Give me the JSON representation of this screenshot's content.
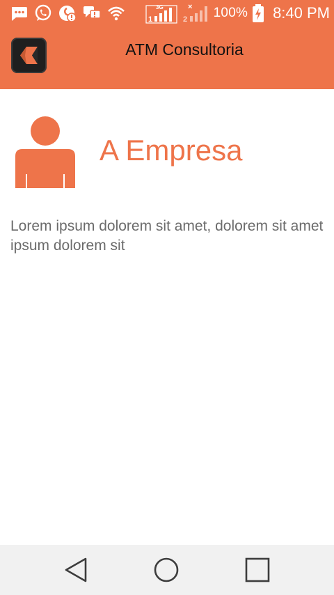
{
  "status_bar": {
    "battery_percent": "100%",
    "time": "8:40 PM",
    "network_type": "3G",
    "sim1_label": "1",
    "sim2_label": "2",
    "icons": [
      "messages-icon",
      "whatsapp-icon",
      "notification-icon",
      "chat-icon",
      "wifi-icon",
      "signal-sim1-icon",
      "signal-sim2-icon",
      "battery-charging-icon"
    ]
  },
  "app_bar": {
    "title": "ATM Consultoria",
    "logo_icon": "app-logo-icon"
  },
  "main": {
    "section_icon": "person-icon",
    "section_title": "A Empresa",
    "description": "Lorem ipsum dolorem sit amet, dolorem sit amet ipsum dolorem sit"
  },
  "nav_bar": {
    "buttons": [
      "back-icon",
      "home-icon",
      "recent-apps-icon"
    ]
  },
  "colors": {
    "accent": "#ee744a",
    "text_gray": "#6b6b6b",
    "nav_background": "#f1f1f1"
  }
}
